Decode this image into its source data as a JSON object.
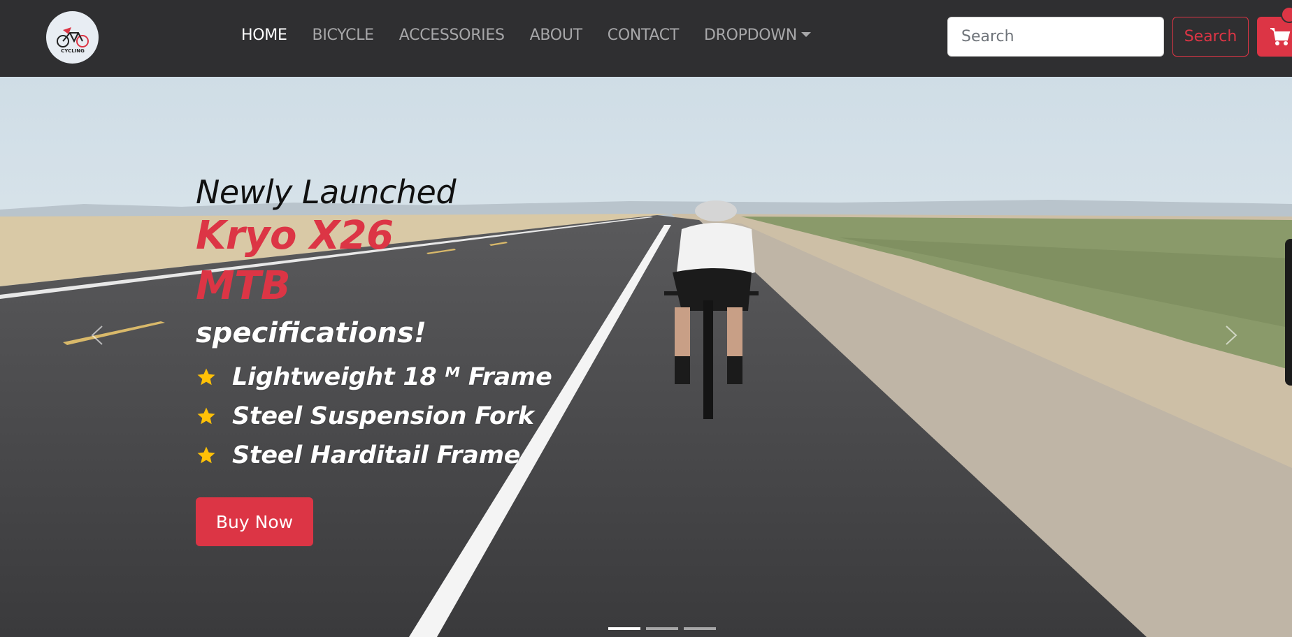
{
  "navbar": {
    "logo_text": "CYCLING",
    "links": [
      {
        "label": "HOME",
        "active": true
      },
      {
        "label": "BICYCLE",
        "active": false
      },
      {
        "label": "ACCESSORIES",
        "active": false
      },
      {
        "label": "ABOUT",
        "active": false
      },
      {
        "label": "CONTACT",
        "active": false
      },
      {
        "label": "DROPDOWN",
        "active": false
      }
    ],
    "search_placeholder": "Search",
    "search_button": "Search",
    "cart_icon": "cart-icon"
  },
  "hero": {
    "line1": "Newly Launched",
    "title_line1": "Kryo X26",
    "title_line2": "MTB",
    "specs": "specifications!",
    "features": [
      "Lightweight 18 ᴹ Frame",
      "Steel Suspension Fork",
      "Steel Harditail Frame"
    ],
    "cta": "Buy Now",
    "slides_total": 3,
    "active_slide": 1
  },
  "colors": {
    "navbar_bg": "#2f2f31",
    "accent": "#dc3545",
    "star": "#ffc107"
  }
}
